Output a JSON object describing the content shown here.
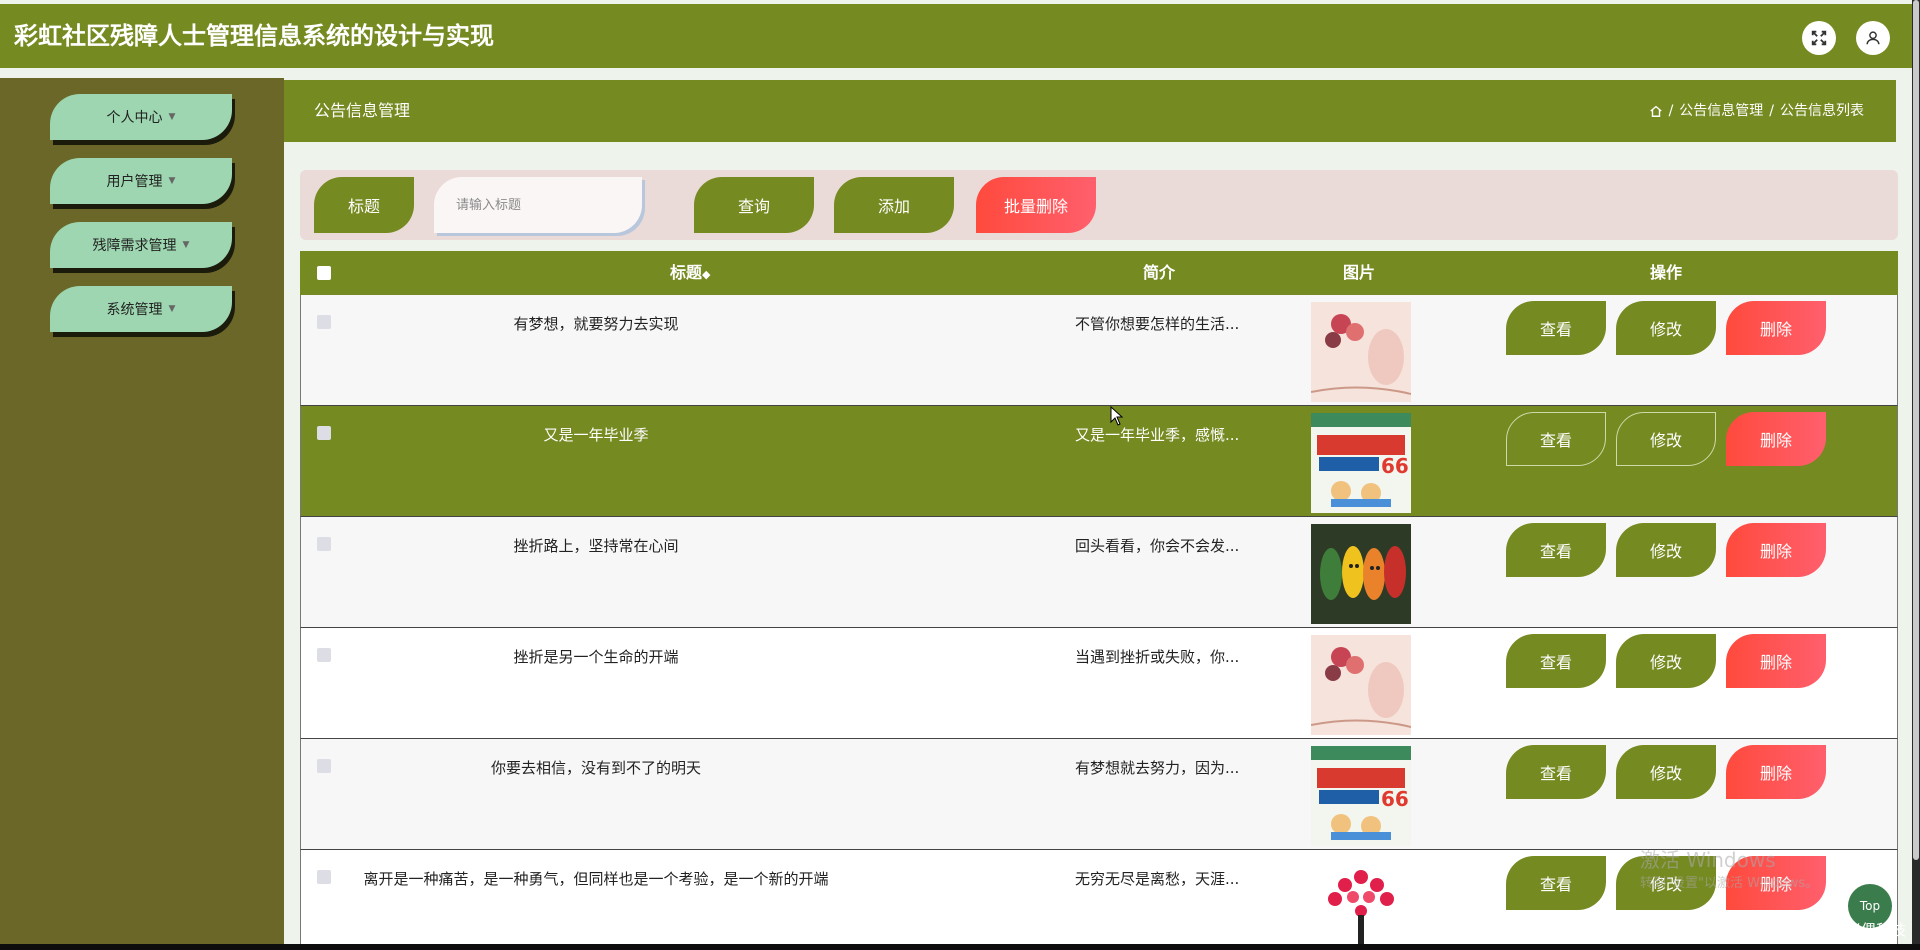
{
  "app": {
    "title": "彩虹社区残障人士管理信息系统的设计与实现"
  },
  "sidebar": {
    "items": [
      {
        "label": "个人中心"
      },
      {
        "label": "用户管理"
      },
      {
        "label": "残障需求管理"
      },
      {
        "label": "系统管理"
      }
    ]
  },
  "page": {
    "title": "公告信息管理",
    "breadcrumb": [
      "公告信息管理",
      "公告信息列表"
    ],
    "breadcrumb_sep": "/"
  },
  "search": {
    "label": "标题",
    "placeholder": "请输入标题",
    "query_label": "查询",
    "add_label": "添加",
    "batch_delete_label": "批量删除"
  },
  "table": {
    "headers": {
      "title": "标题",
      "sort": "◆",
      "intro": "简介",
      "image": "图片",
      "actions": "操作"
    },
    "action_labels": {
      "view": "查看",
      "edit": "修改",
      "delete": "删除"
    },
    "rows": [
      {
        "title": "有梦想，就要努力去实现",
        "intro": "不管你想要怎样的生活...",
        "image": "balloon-art"
      },
      {
        "title": "又是一年毕业季",
        "intro": "又是一年毕业季，感慨...",
        "image": "health-book-cover"
      },
      {
        "title": "挫折路上，坚持常在心间",
        "intro": "回头看看，你会不会发...",
        "image": "color-leaves"
      },
      {
        "title": "挫折是另一个生命的开端",
        "intro": "当遇到挫折或失败，你...",
        "image": "balloon-art"
      },
      {
        "title": "你要去相信，没有到不了的明天",
        "intro": "有梦想就去努力，因为...",
        "image": "health-book-cover"
      },
      {
        "title": "离开是一种痛苦，是一种勇气，但同样也是一个考验，是一个新的开端",
        "intro": "无穷无尽是离愁，天涯...",
        "image": "heart-tree"
      }
    ]
  },
  "overlay": {
    "watermark_title": "激活 Windows",
    "watermark_sub": "转到\"设置\"以激活 Windows。",
    "top_button": "Top",
    "source_mark": "CSDN @米偶科技"
  },
  "colors": {
    "brand": "#758a21",
    "sidebar": "#6b6729",
    "menu": "#9dd6b0",
    "danger": "#ff4a3d"
  }
}
